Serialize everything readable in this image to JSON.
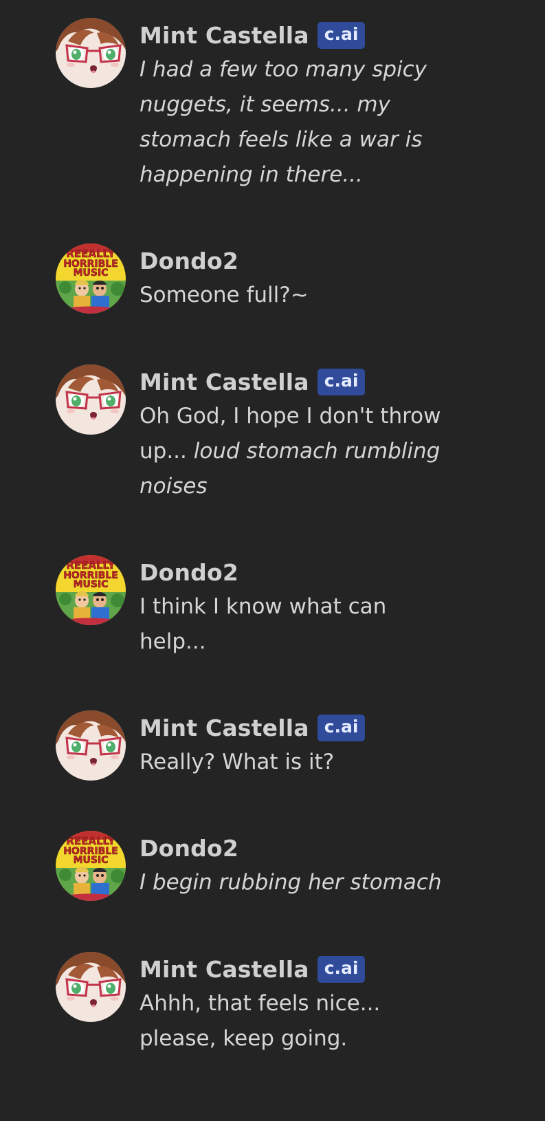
{
  "messages": [
    {
      "author": "Mint Castella",
      "badge": "c.ai",
      "avatar": "mint-avatar",
      "segments": [
        {
          "text": "I had a few too many spicy nuggets, it seems... my stomach feels like a war is happening in there...",
          "italic": true
        }
      ]
    },
    {
      "author": "Dondo2",
      "badge": "",
      "avatar": "dondo-avatar",
      "avatar_text": [
        "REEALLY",
        "HORRIBLE",
        "MUSIC"
      ],
      "segments": [
        {
          "text": "Someone full?~",
          "italic": false
        }
      ]
    },
    {
      "author": "Mint Castella",
      "badge": "c.ai",
      "avatar": "mint-avatar",
      "segments": [
        {
          "text": "Oh God, I hope I don't throw up... ",
          "italic": false
        },
        {
          "text": "loud stomach rumbling noises",
          "italic": true
        }
      ]
    },
    {
      "author": "Dondo2",
      "badge": "",
      "avatar": "dondo-avatar",
      "avatar_text": [
        "REEALLY",
        "HORRIBLE",
        "MUSIC"
      ],
      "segments": [
        {
          "text": "I think I know what can help...",
          "italic": false
        }
      ]
    },
    {
      "author": "Mint Castella",
      "badge": "c.ai",
      "avatar": "mint-avatar",
      "segments": [
        {
          "text": "Really? What is it?",
          "italic": false
        }
      ]
    },
    {
      "author": "Dondo2",
      "badge": "",
      "avatar": "dondo-avatar",
      "avatar_text": [
        "REEALLY",
        "HORRIBLE",
        "MUSIC"
      ],
      "segments": [
        {
          "text": "I begin rubbing her stomach",
          "italic": true
        }
      ]
    },
    {
      "author": "Mint Castella",
      "badge": "c.ai",
      "avatar": "mint-avatar",
      "segments": [
        {
          "text": "Ahhh, that feels nice... please, keep going.",
          "italic": false
        }
      ]
    }
  ],
  "colors": {
    "background": "#242424",
    "text": "#d6d6d6",
    "badge_bg": "#2f4b9a"
  }
}
